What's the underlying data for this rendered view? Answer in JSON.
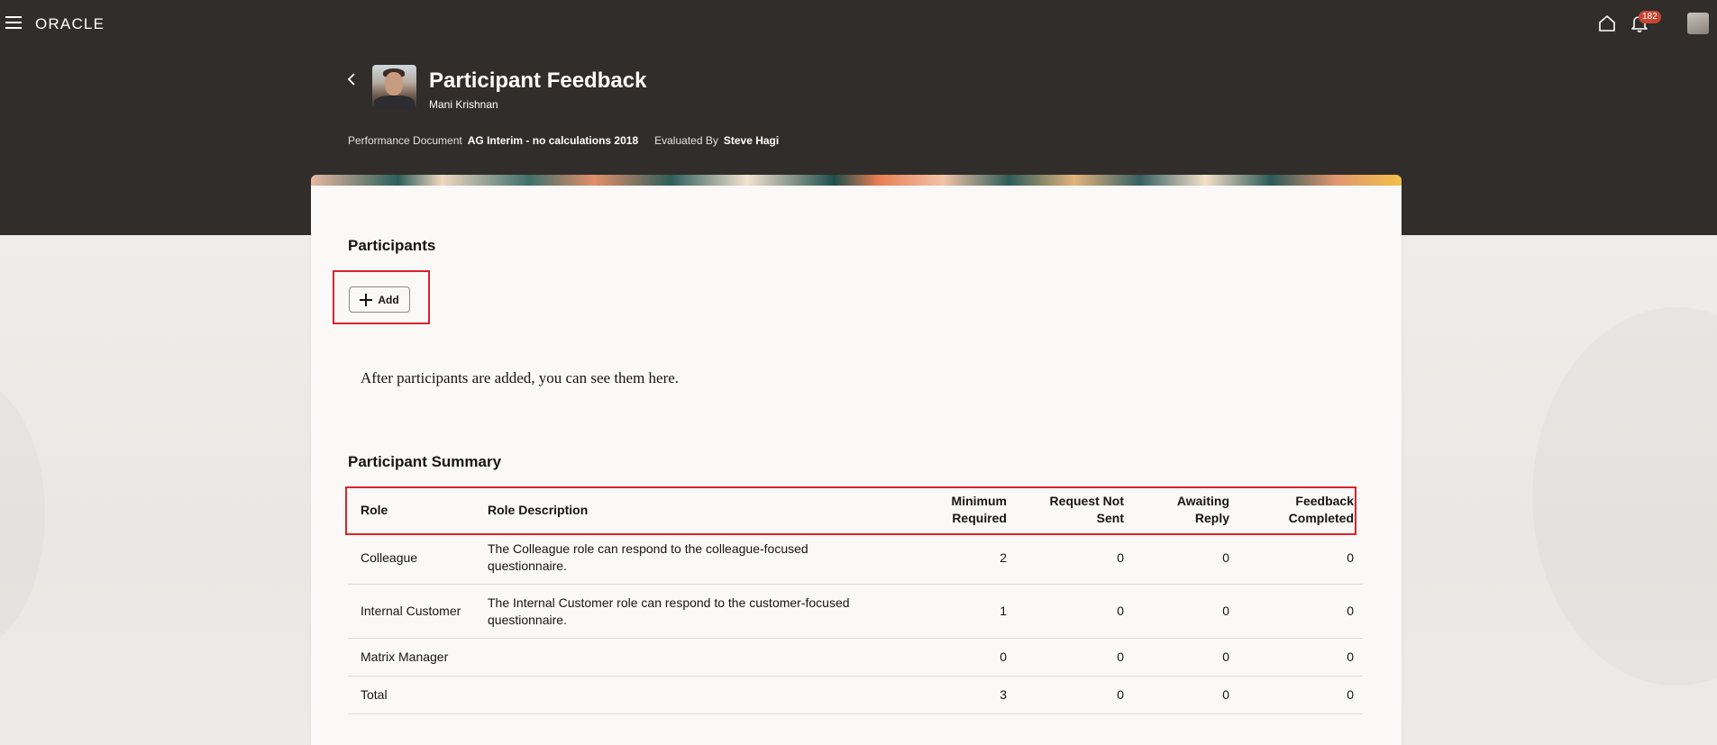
{
  "header": {
    "logo": "ORACLE",
    "notification_count": "182"
  },
  "page": {
    "title": "Participant Feedback",
    "person_name": "Mani Krishnan",
    "performance_document_label": "Performance Document",
    "performance_document_value": "AG Interim - no calculations 2018",
    "evaluated_by_label": "Evaluated By",
    "evaluated_by_value": "Steve Hagi"
  },
  "participants": {
    "title": "Participants",
    "add_label": "Add",
    "empty_message": "After participants are added, you can see them here."
  },
  "summary": {
    "title": "Participant Summary",
    "columns": {
      "role": "Role",
      "role_description": "Role Description",
      "minimum_required_1": "Minimum",
      "minimum_required_2": "Required",
      "request_not_sent_1": "Request Not",
      "request_not_sent_2": "Sent",
      "awaiting_reply_1": "Awaiting",
      "awaiting_reply_2": "Reply",
      "feedback_completed_1": "Feedback",
      "feedback_completed_2": "Completed"
    },
    "rows": [
      {
        "role": "Colleague",
        "description_1": "The Colleague role can respond to the colleague-focused",
        "description_2": "questionnaire.",
        "minimum": "2",
        "not_sent": "0",
        "awaiting": "0",
        "completed": "0"
      },
      {
        "role": "Internal Customer",
        "description_1": "The Internal Customer role can respond to the customer-focused",
        "description_2": "questionnaire.",
        "minimum": "1",
        "not_sent": "0",
        "awaiting": "0",
        "completed": "0"
      },
      {
        "role": "Matrix Manager",
        "description_1": "",
        "description_2": "",
        "minimum": "0",
        "not_sent": "0",
        "awaiting": "0",
        "completed": "0"
      },
      {
        "role": "Total",
        "description_1": "",
        "description_2": "",
        "minimum": "3",
        "not_sent": "0",
        "awaiting": "0",
        "completed": "0"
      }
    ]
  },
  "colors": {
    "header_bg": "#312d2a",
    "highlight": "#d8232a",
    "badge": "#c74634"
  }
}
